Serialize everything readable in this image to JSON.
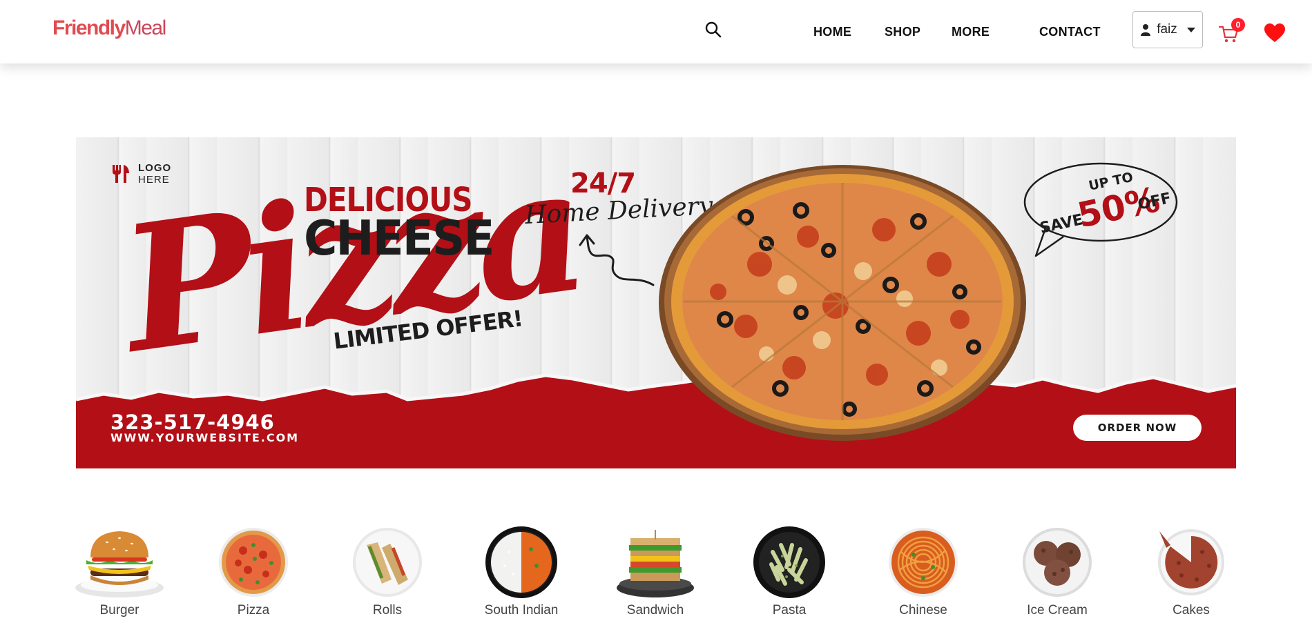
{
  "header": {
    "logo_bold": "Friendly",
    "logo_light": "Meal",
    "nav": [
      "HOME",
      "SHOP",
      "MORE",
      "CONTACT"
    ],
    "user_name": "faiz",
    "cart_count": "0"
  },
  "banner": {
    "logo_line1": "LOGO",
    "logo_line2": "HERE",
    "delicious": "DELICIOUS",
    "cheese": "CHEESE",
    "pizza_script": "Pizza",
    "limited": "LIMITED OFFER!",
    "h247": "24/7",
    "home_delivery": "Home Delivery",
    "up_to": "UP TO",
    "save": "SAVE",
    "percent": "50%",
    "off": "OFF",
    "phone": "323-517-4946",
    "website": "WWW.YOURWEBSITE.COM",
    "order_now": "ORDER NOW"
  },
  "categories": [
    "Burger",
    "Pizza",
    "Rolls",
    "South Indian",
    "Sandwich",
    "Pasta",
    "Chinese",
    "Ice Cream",
    "Cakes"
  ],
  "colors": {
    "brand": "#e14b4f",
    "banner_red": "#b30f16",
    "badge": "#ff1f2d"
  }
}
